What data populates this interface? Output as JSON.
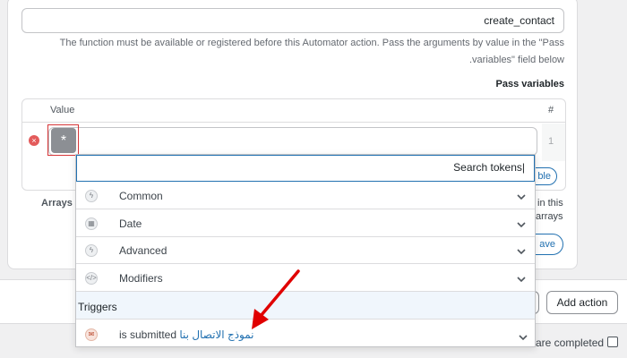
{
  "function_field": {
    "value": "create_contact"
  },
  "help": {
    "line1": "The function must be available or registered before this Automator action. Pass the arguments by value in the \"Pass",
    "line2": ".variables\" field below"
  },
  "pass_variables": {
    "label": "Pass variables",
    "columns": {
      "value": "Value",
      "number": "#"
    },
    "rows": [
      {
        "number": "1"
      }
    ]
  },
  "token_button": {
    "symbol": "*"
  },
  "arrays_label": "Arrays",
  "peek": {
    "text1": "in this",
    "text2": "arrays",
    "btn1": "ble",
    "btn2": "ave"
  },
  "token_dropdown": {
    "search_placeholder": "Search tokens",
    "categories": [
      {
        "label": "Common",
        "icon": "bolt-icon"
      },
      {
        "label": "Date",
        "icon": "calendar-icon"
      },
      {
        "label": "Advanced",
        "icon": "bolt-icon"
      },
      {
        "label": "Modifiers",
        "icon": "code-icon"
      }
    ],
    "triggers_heading": "Triggers",
    "trigger": {
      "prefix": "is submitted",
      "form_name": "نموذج الاتصال بنا",
      "icon": "form-plugin-icon"
    }
  },
  "footer": {
    "add_action": "Add action",
    "completed_text": "are completed"
  },
  "colors": {
    "accent": "#2271b1",
    "remove": "#e35b5b",
    "highlight_box": "#d63638",
    "arrow": "#e00000"
  }
}
